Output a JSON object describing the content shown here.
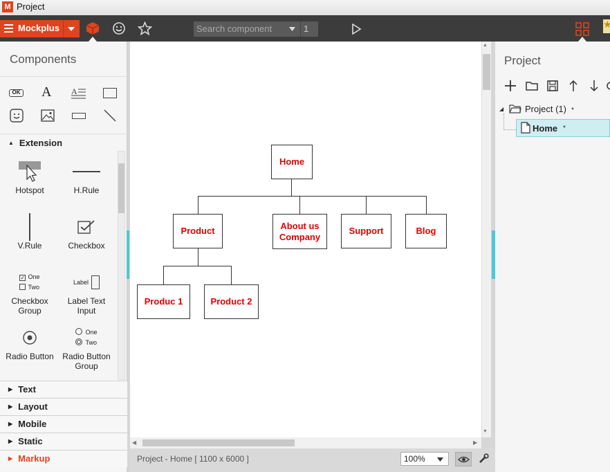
{
  "window": {
    "title": "Project"
  },
  "toolbar": {
    "brand": "Mockplus",
    "search_placeholder": "Search component",
    "page_number": "1"
  },
  "left_panel": {
    "title": "Components",
    "section": "Extension",
    "components": [
      {
        "label": "Hotspot"
      },
      {
        "label": "H.Rule"
      },
      {
        "label": "V.Rule"
      },
      {
        "label": "Checkbox"
      },
      {
        "label": "Checkbox Group"
      },
      {
        "label": "Label Text Input"
      },
      {
        "label": "Radio Button"
      },
      {
        "label": "Radio Button Group"
      }
    ],
    "icon_samples": {
      "ok": "OK",
      "label": "Label",
      "one": "One",
      "two": "Two"
    },
    "categories": [
      {
        "label": "Text"
      },
      {
        "label": "Layout"
      },
      {
        "label": "Mobile"
      },
      {
        "label": "Static"
      },
      {
        "label": "Markup"
      }
    ]
  },
  "canvas": {
    "nodes": {
      "home": "Home",
      "product": "Product",
      "about": "About us Company",
      "support": "Support",
      "blog": "Blog",
      "product1": "Produc 1",
      "product2": "Product 2"
    }
  },
  "status": {
    "path": "Project - Home [ 1100 x 6000 ]",
    "zoom": "100%"
  },
  "right_panel": {
    "title": "Project",
    "tree": [
      {
        "label": "Project (1)",
        "marker": "*"
      },
      {
        "label": "Home",
        "marker": "*"
      }
    ]
  },
  "colors": {
    "accent": "#e0441e",
    "node_text": "#e00000",
    "selection": "#cfeef2",
    "marker_bar": "#4cc8d8"
  }
}
